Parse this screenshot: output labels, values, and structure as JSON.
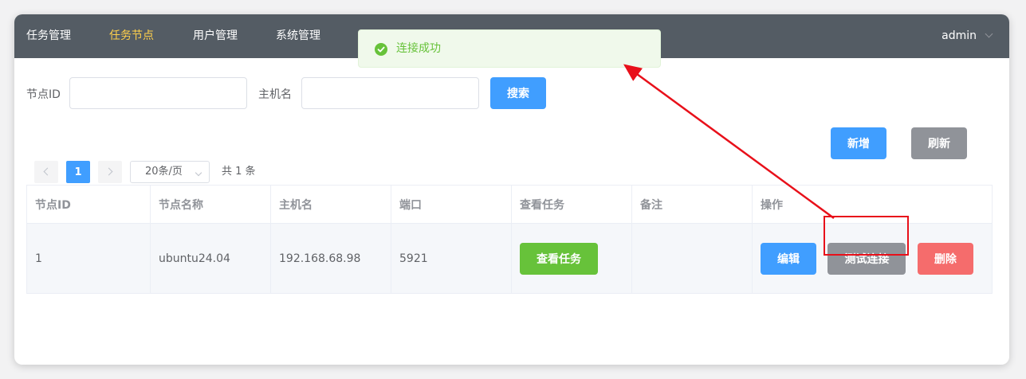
{
  "nav": {
    "items": [
      {
        "label": "任务管理"
      },
      {
        "label": "任务节点"
      },
      {
        "label": "用户管理"
      },
      {
        "label": "系统管理"
      }
    ],
    "user": "admin"
  },
  "search": {
    "node_id_label": "节点ID",
    "node_id_value": "",
    "host_label": "主机名",
    "host_value": "",
    "search_button": "搜索"
  },
  "toolbar": {
    "add_button": "新增",
    "refresh_button": "刷新"
  },
  "pagination": {
    "current_page": "1",
    "page_size": "20条/页",
    "total": "共 1 条"
  },
  "table": {
    "columns": [
      "节点ID",
      "节点名称",
      "主机名",
      "端口",
      "查看任务",
      "备注",
      "操作"
    ],
    "rows": [
      {
        "id": "1",
        "name": "ubuntu24.04",
        "host": "192.168.68.98",
        "port": "5921",
        "view_tasks_button": "查看任务",
        "remark": "",
        "edit_button": "编辑",
        "test_button": "测试连接",
        "delete_button": "删除"
      }
    ]
  },
  "toast": {
    "message": "连接成功",
    "color": "#67c23a"
  },
  "annotation": {
    "color": "#e8101a"
  },
  "colors": {
    "nav_bg": "#545c64",
    "nav_active": "#ffd04b",
    "primary": "#409eff",
    "info": "#909399",
    "success": "#67c23a",
    "danger": "#f56c6c"
  }
}
